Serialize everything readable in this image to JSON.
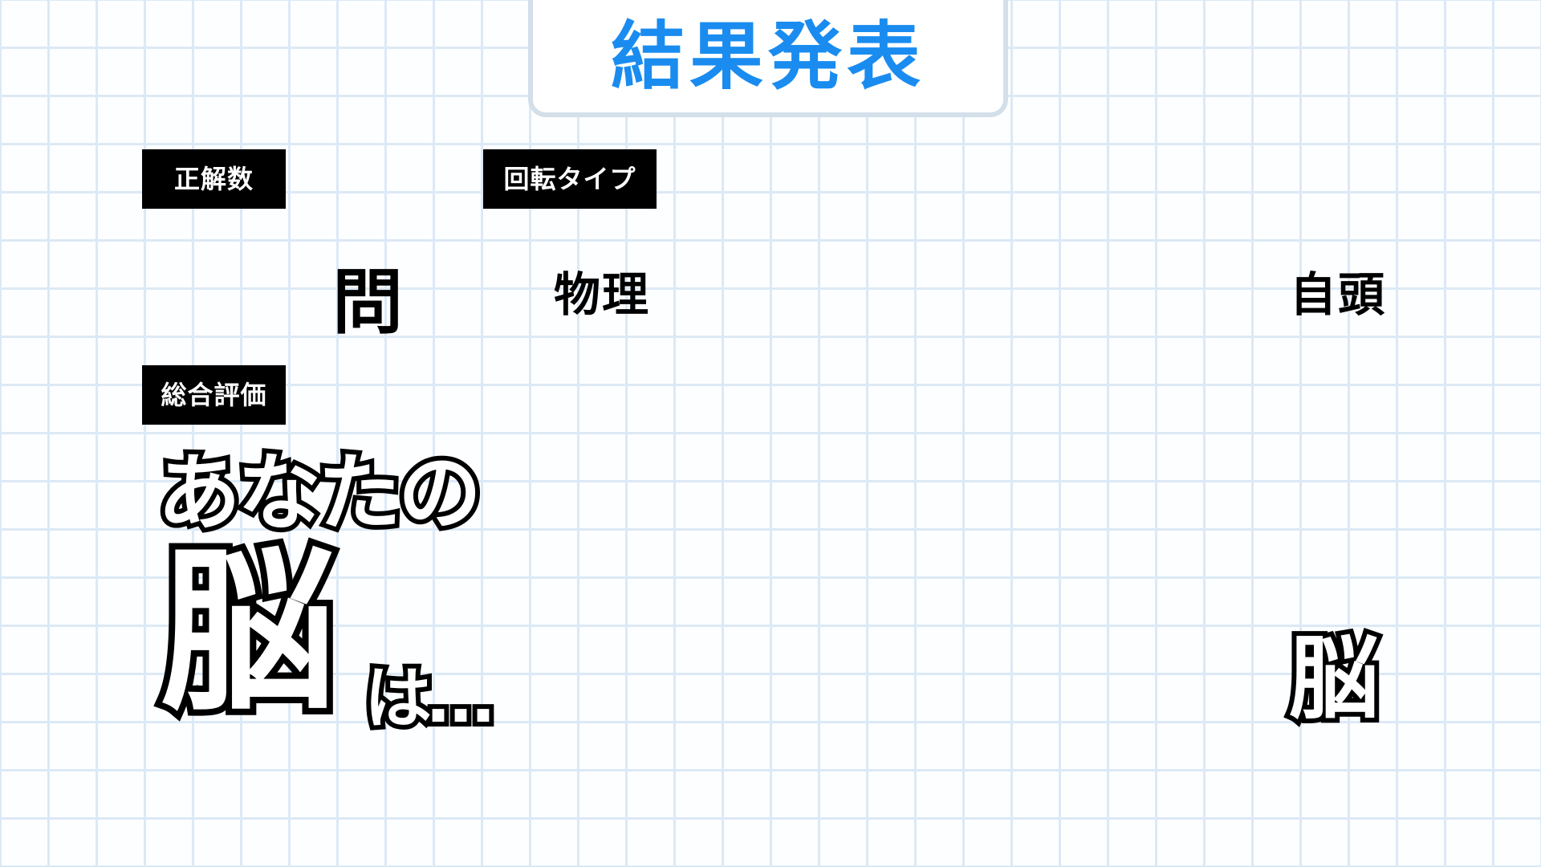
{
  "header": {
    "title": "結果発表"
  },
  "labels": {
    "correct_count": "正解数",
    "rotation_type": "回転タイプ",
    "overall_rating": "総合評価"
  },
  "correct_count": {
    "unit": "問"
  },
  "rotation_type": {
    "left_value": "物理",
    "right_value": "自頭"
  },
  "evaluation": {
    "line1": "あなたの",
    "big_char": "脳",
    "trailing": "は…",
    "result": "脳"
  },
  "colors": {
    "title": "#1a8cf0",
    "label_bg": "#000000",
    "label_text": "#ffffff",
    "grid_line": "#dce9f6",
    "panel_border": "#d3dfe9"
  }
}
